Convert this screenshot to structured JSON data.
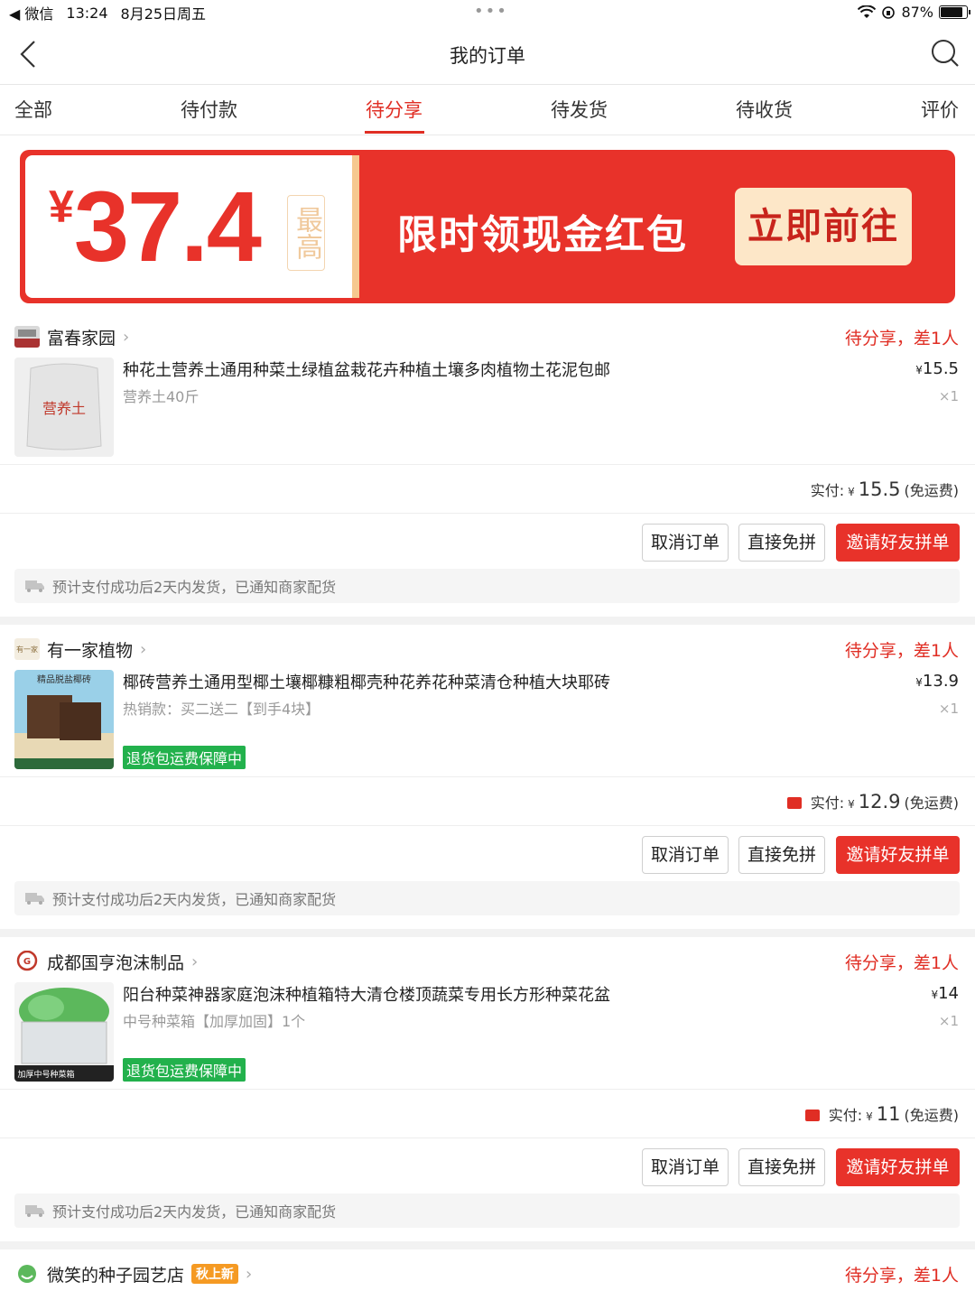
{
  "status_bar": {
    "back_app": "◀ 微信",
    "time": "13:24",
    "date": "8月25日周五",
    "battery": "87%",
    "battery_level": 0.87
  },
  "nav": {
    "title": "我的订单"
  },
  "tabs": [
    {
      "label": "全部"
    },
    {
      "label": "待付款"
    },
    {
      "label": "待分享"
    },
    {
      "label": "待发货"
    },
    {
      "label": "待收货"
    },
    {
      "label": "评价"
    }
  ],
  "active_tab": "待分享",
  "banner": {
    "currency": "¥",
    "amount": "37.4",
    "tag": "最高",
    "text": "限时领现金红包",
    "button": "立即前往"
  },
  "orders": [
    {
      "store": "富春家园",
      "status": "待分享，差1人",
      "title": "种花土营养土通用种菜土绿植盆栽花卉种植土壤多肉植物土花泥包邮",
      "spec": "营养土40斤",
      "price": "15.5",
      "qty": "×1",
      "paid_label": "实付:",
      "paid_amount": "15.5",
      "paid_note": "(免运费)",
      "buttons": [
        "取消订单",
        "直接免拼",
        "邀请好友拼单"
      ],
      "ship_note": "预计支付成功后2天内发货，已通知商家配货",
      "thumb_text": "营养土"
    },
    {
      "store": "有一家植物",
      "status": "待分享，差1人",
      "title": "椰砖营养土通用型椰土壤椰糠粗椰壳种花养花种菜清仓种植大块耶砖",
      "spec": "热销款：买二送二【到手4块】",
      "guarantee": "退货包运费保障中",
      "price": "13.9",
      "qty": "×1",
      "paid_label": "实付:",
      "paid_amount": "12.9",
      "paid_note": "(免运费)",
      "buttons": [
        "取消订单",
        "直接免拼",
        "邀请好友拼单"
      ],
      "ship_note": "预计支付成功后2天内发货，已通知商家配货",
      "thumb_text": "精品脱盐椰砖"
    },
    {
      "store": "成都国亨泡沫制品",
      "status": "待分享，差1人",
      "title": "阳台种菜神器家庭泡沫种植箱特大清仓楼顶蔬菜专用长方形种菜花盆",
      "spec": "中号种菜箱【加厚加固】1个",
      "guarantee": "退货包运费保障中",
      "price": "14",
      "qty": "×1",
      "paid_label": "实付:",
      "paid_amount": "11",
      "paid_note": "(免运费)",
      "buttons": [
        "取消订单",
        "直接免拼",
        "邀请好友拼单"
      ],
      "ship_note": "预计支付成功后2天内发货，已通知商家配货",
      "thumb_text": "加厚中号种菜箱"
    },
    {
      "store": "微笑的种子园艺店",
      "badge": "秋上新",
      "status": "待分享，差1人"
    }
  ],
  "currency_small": "¥",
  "colors": {
    "accent": "#e02e24",
    "banner": "#e8322a",
    "guarantee": "#22b14c"
  }
}
